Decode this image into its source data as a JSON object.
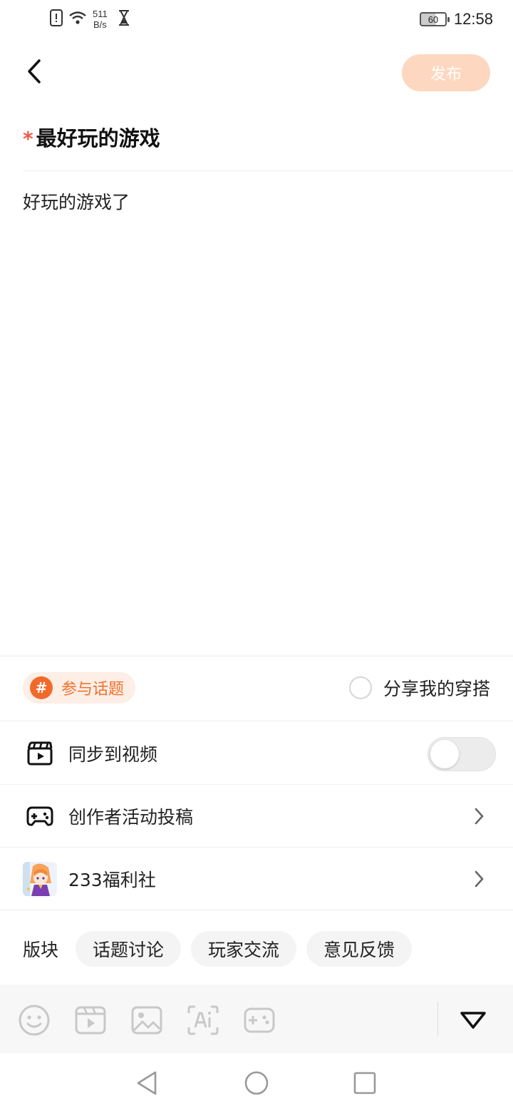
{
  "status_bar": {
    "net_speed_value": "511",
    "net_speed_unit": "B/s",
    "battery_level": "60",
    "time": "12:58"
  },
  "header": {
    "publish_label": "发布"
  },
  "post": {
    "title": "最好玩的游戏",
    "required_mark": "*",
    "body": "好玩的游戏了"
  },
  "options": {
    "topic_icon_text": "#",
    "topic_label": "参与话题",
    "share_outfit_label": "分享我的穿搭",
    "sync_video_label": "同步到视频",
    "sync_video_enabled": false,
    "creator_event_label": "创作者活动投稿",
    "welfare_label": "233福利社"
  },
  "section": {
    "label": "版块",
    "chips": [
      "话题讨论",
      "玩家交流",
      "意见反馈"
    ]
  },
  "toolbar": {
    "icons": [
      "emoji-icon",
      "video-icon",
      "image-icon",
      "ai-icon",
      "game-icon",
      "collapse-icon"
    ]
  },
  "colors": {
    "accent": "#f26a2b",
    "publish_disabled": "#fdd7bf",
    "required": "#ef5a4a"
  }
}
